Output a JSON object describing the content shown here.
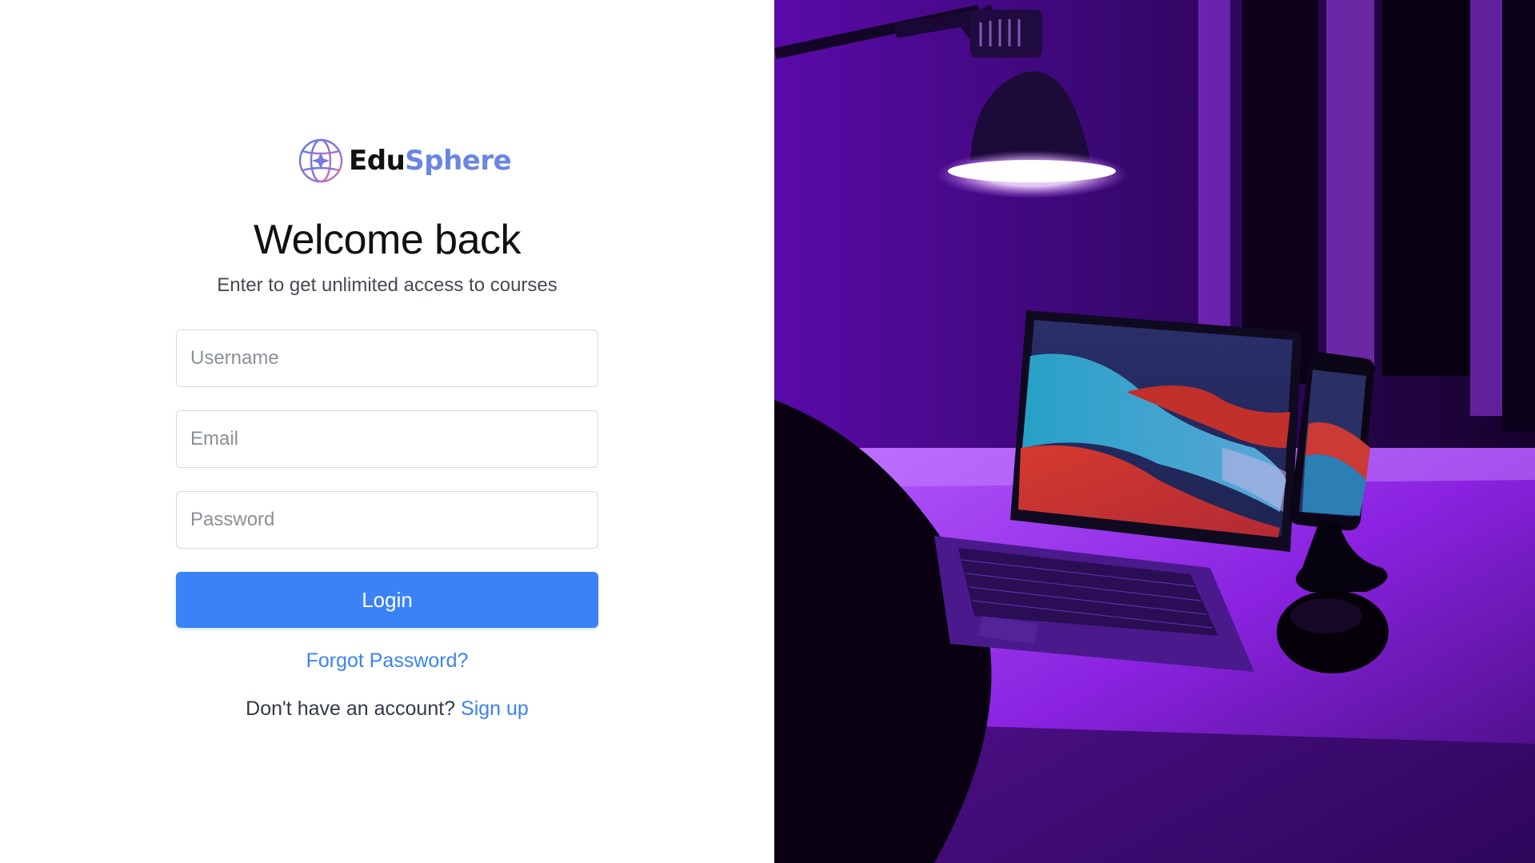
{
  "brand": {
    "name_part1": "Edu",
    "name_part2": "Sphere",
    "logo_icon": "globe-sparkle-icon",
    "colors": {
      "dark": "#111111",
      "accent": "#6a86e2"
    }
  },
  "login": {
    "title": "Welcome back",
    "subtitle": "Enter to get unlimited access to courses",
    "username_placeholder": "Username",
    "email_placeholder": "Email",
    "password_placeholder": "Password",
    "login_label": "Login",
    "forgot_label": "Forgot Password?",
    "no_account_text": "Don't have an account?",
    "signup_label": "Sign up"
  },
  "theme": {
    "primary": "#3b82f6",
    "scene_accent": "#8a1fe0"
  },
  "hero_image": {
    "subject": "laptop-and-phone-on-desk-under-purple-lamp"
  }
}
